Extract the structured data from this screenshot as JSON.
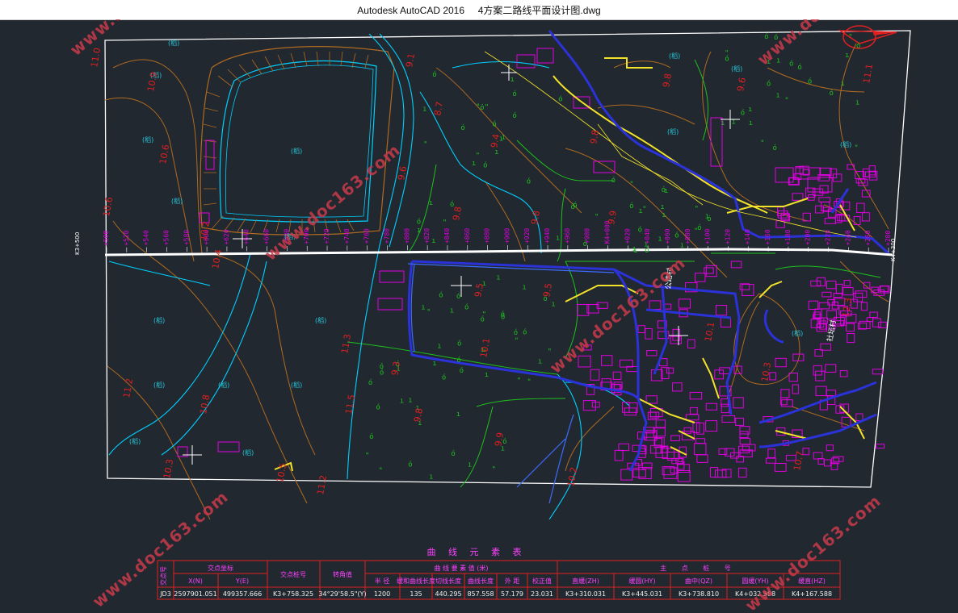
{
  "app": {
    "title": "Autodesk AutoCAD 2016     4方案二路线平面设计图.dwg"
  },
  "watermark": {
    "text": "www.doc163.com",
    "color": "#c83a4a"
  },
  "colors": {
    "background": "#212830",
    "boundary": "#ffffff",
    "road_alignment": "#ffffff",
    "water_channel": "#00d0ff",
    "contour": "#b06a20",
    "vegetation": "#1ec01e",
    "building": "#e000e0",
    "road_edge_blue": "#2a32d8",
    "road_yellow": "#f2e32a",
    "elevation_text": "#e02020",
    "table_frame": "#e02020",
    "table_header": "#ff40ff"
  },
  "map": {
    "village_labels": [
      "公路村",
      "社坛村"
    ],
    "station_stakes": [
      "+500",
      "+520",
      "+540",
      "+560",
      "+580",
      "+600",
      "+620",
      "+640",
      "+660",
      "+680",
      "+700",
      "+720",
      "+740",
      "+760",
      "+780",
      "+800",
      "+820",
      "+840",
      "+860",
      "+880",
      "+900",
      "+920",
      "+940",
      "+960",
      "+980",
      "K4+000",
      "+020",
      "+040",
      "+060",
      "+080",
      "+100",
      "+120",
      "+140",
      "+160",
      "+180",
      "+200",
      "+220",
      "+240",
      "+260",
      "+280"
    ],
    "left_chainage_label": "K3+500",
    "right_chainage_label": "K4+300",
    "elevations": [
      "11.0",
      "10.9",
      "10.6",
      "10.6",
      "10.2",
      "10.4",
      "9.8",
      "9.1",
      "8.7",
      "9.4",
      "9.6",
      "9.8",
      "9.8",
      "9.9",
      "9.8",
      "9.5",
      "9.5",
      "10.1",
      "9.3",
      "9.8",
      "9.9",
      "10.2",
      "10.1",
      "10.3",
      "10.7",
      "11.3",
      "11.2",
      "10.8",
      "11.5",
      "10.3",
      "10.5",
      "11.2",
      "9.6",
      "11.1",
      "12.3"
    ],
    "paddy_symbol": "(稻)"
  },
  "table": {
    "title": "曲 线 元 素 表",
    "col_intersection_no": "交点号",
    "col_coordinates": "交点坐标",
    "col_x": "X(N)",
    "col_y": "Y(E)",
    "col_stake": "交点桩号",
    "col_angle": "转角值",
    "col_elements": "曲 线 要 素 值 (米)",
    "col_radius": "半 径",
    "col_spiral": "缓和曲线长度",
    "col_tangent": "切线长度",
    "col_curve": "曲线长度",
    "col_external": "外 距",
    "col_correction": "校正值",
    "col_main_points": "主 点 桩 号",
    "col_zh": "直缓(ZH)",
    "col_hy": "缓圆(HY)",
    "col_qz": "曲中(QZ)",
    "col_yh": "圆缓(YH)",
    "col_hz": "缓直(HZ)",
    "row": {
      "jd": "JD3",
      "x": "2597901.051",
      "y": "499357.666",
      "stake": "K3+758.325",
      "angle": "34°29'58.5\"(Y)",
      "radius": "1200",
      "spiral": "135",
      "tangent": "440.295",
      "curve": "857.558",
      "external": "57.179",
      "correction": "23.031",
      "zh": "K3+310.031",
      "hy": "K3+445.031",
      "qz": "K3+738.810",
      "yh": "K4+032.588",
      "hz": "K4+167.588"
    }
  }
}
